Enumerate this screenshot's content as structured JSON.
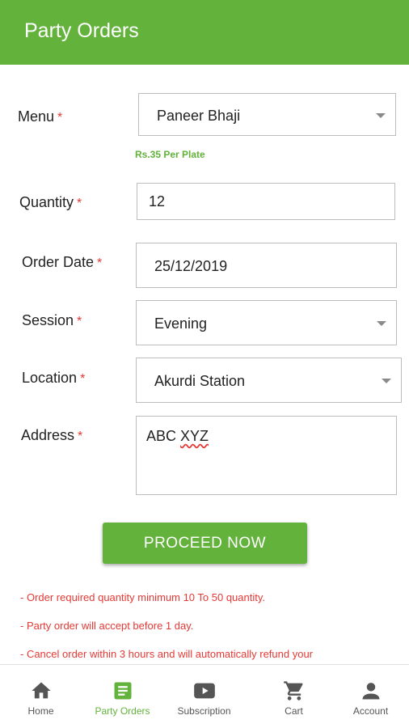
{
  "appbar": {
    "title": "Party Orders"
  },
  "form": {
    "menu": {
      "label": "Menu",
      "required_mark": "*",
      "value": "Paneer Bhaji"
    },
    "price_note": "Rs.35 Per Plate",
    "quantity": {
      "label": "Quantity",
      "required_mark": "*",
      "value": "12"
    },
    "order_date": {
      "label": "Order Date",
      "required_mark": "*",
      "value": "25/12/2019"
    },
    "session": {
      "label": "Session",
      "required_mark": "*",
      "value": "Evening"
    },
    "location": {
      "label": "Location",
      "required_mark": "*",
      "value": "Akurdi Station"
    },
    "address": {
      "label": "Address",
      "required_mark": "*",
      "value_part1": "ABC ",
      "value_part2": "XYZ"
    }
  },
  "proceed_label": "PROCEED NOW",
  "notes": [
    "- Order required quantity minimum 10 To 50 quantity.",
    "- Party order will accept before 1 day.",
    "- Cancel order within 3 hours and will automatically refund your"
  ],
  "bottom_nav": {
    "items": [
      {
        "label": "Home",
        "icon": "home-icon"
      },
      {
        "label": "Party Orders",
        "icon": "list-icon",
        "active": true
      },
      {
        "label": "Subscription",
        "icon": "play-icon"
      },
      {
        "label": "Cart",
        "icon": "cart-icon"
      },
      {
        "label": "Account",
        "icon": "person-icon"
      }
    ]
  },
  "colors": {
    "primary": "#62b23b",
    "required": "#e53935",
    "note": "#e53935",
    "inactive_nav": "#555555"
  }
}
